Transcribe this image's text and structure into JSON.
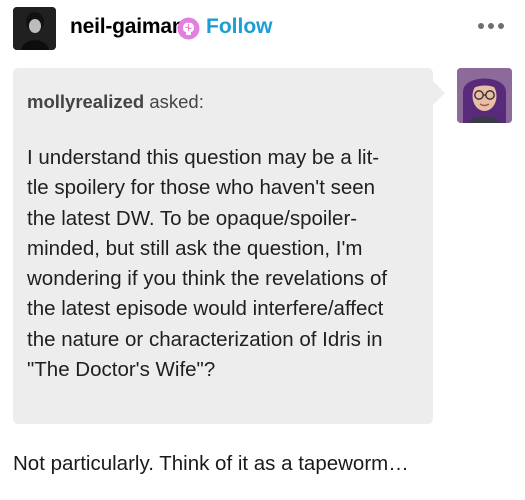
{
  "post": {
    "author": {
      "name": "neil-gaiman",
      "badge_icon": "brain-badge-icon",
      "follow_label": "Follow",
      "follow_color": "#1a9ed4"
    },
    "more_icon": "more-options-icon",
    "ask": {
      "asker_name": "mollyrealized",
      "asked_label": "asked:",
      "bubble_color": "#ededed",
      "question_lines": [
        "I understand this question may be a lit-",
        "tle spoilery for those who haven't seen",
        "the latest DW.  To be opaque/spoiler-",
        "minded, but still ask the question, I'm",
        "wondering if you think the revelations of",
        "the latest episode would interfere/affect",
        "the nature or characterization of Idris in",
        "\"The Doctor's Wife\"?"
      ]
    },
    "answer": "Not particularly. Think of it as a tapeworm…"
  }
}
